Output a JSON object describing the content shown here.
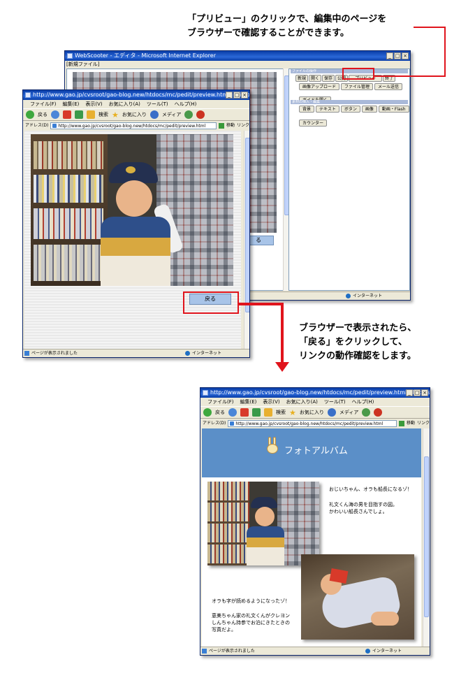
{
  "callouts": {
    "top_line1": "「プリビュー」のクリックで、編集中のページを",
    "top_line2": "ブラウザーで確認することができます。",
    "middle_line1": "ブラウザーで表示されたら、",
    "middle_line2": "「戻る」をクリックして、",
    "middle_line3": "リンクの動作確認をします。"
  },
  "editor_window": {
    "title": "WebScooter - エディタ - Microsoft Internet Explorer",
    "file_label": "[新規ファイル]",
    "panel1_header": "ファイルの操作",
    "buttons_row1": [
      "新規",
      "開く",
      "保存",
      "公開",
      "プリビュー",
      "終了"
    ],
    "buttons_row2": [
      "画像アップロード",
      "ファイル管理",
      "メール送信"
    ],
    "buttons_row3": [
      "ガイドを開く"
    ],
    "panel2_header": "素材の挿入・編集",
    "buttons_row4": [
      "背景",
      "テキスト",
      "ボタン",
      "画像",
      "動画・Flash"
    ],
    "buttons_row5": [
      "カウンター"
    ],
    "partial_button": "る",
    "status_zone": "インターネット"
  },
  "browser_small": {
    "title": "http://www.gao.jp/cvsroot/gao-blog.new/htdocs/mc/pedit/preview.html - Microsoft Internet Ex...",
    "menu": [
      "ファイル(F)",
      "編集(E)",
      "表示(V)",
      "お気に入り(A)",
      "ツール(T)",
      "ヘルプ(H)"
    ],
    "toolbar": [
      "戻る",
      "検索",
      "お気に入り",
      "メディア"
    ],
    "address_label": "アドレス(D)",
    "address": "http://www.gao.jp/cvsroot/gao-blog.new/htdocs/mc/pedit/preview.html",
    "go": "移動",
    "links": "リンク",
    "back_button": "戻る",
    "status": "ページが表示されました",
    "status_zone": "インターネット"
  },
  "browser_large": {
    "title": "http://www.gao.jp/cvsroot/gao-blog.new/htdocs/mc/pedit/preview.html - Microsoft Internet Ex...",
    "menu": [
      "ファイル(F)",
      "編集(E)",
      "表示(V)",
      "お気に入り(A)",
      "ツール(T)",
      "ヘルプ(H)"
    ],
    "toolbar": [
      "戻る",
      "検索",
      "お気に入り",
      "メディア"
    ],
    "address_label": "アドレス(D)",
    "address": "http://www.gao.jp/cvsroot/gao-blog.new/htdocs/mc/pedit/preview.html",
    "go": "移動",
    "links": "リンク",
    "page_title": "フォトアルバム",
    "text1_line1": "おじいちゃん、オラも船長になるゾ！",
    "text1_line2": "礼文くん海の男を目指すの図。",
    "text1_line3": "かわいい船長さんでしょ。",
    "text2_line1": "オラも字が読めるようになったゾ！",
    "text2_line2": "恵美ちゃん家の礼文くんがクレヨン",
    "text2_line3": "しんちゃん持参でお泊にきたときの",
    "text2_line4": "写真だよ。",
    "status": "ページが表示されました",
    "status_zone": "インターネット"
  },
  "colors": {
    "highlight_red": "#e0141c",
    "header_blue": "#5b8fc8",
    "title_blue": "#0a3ea8"
  }
}
